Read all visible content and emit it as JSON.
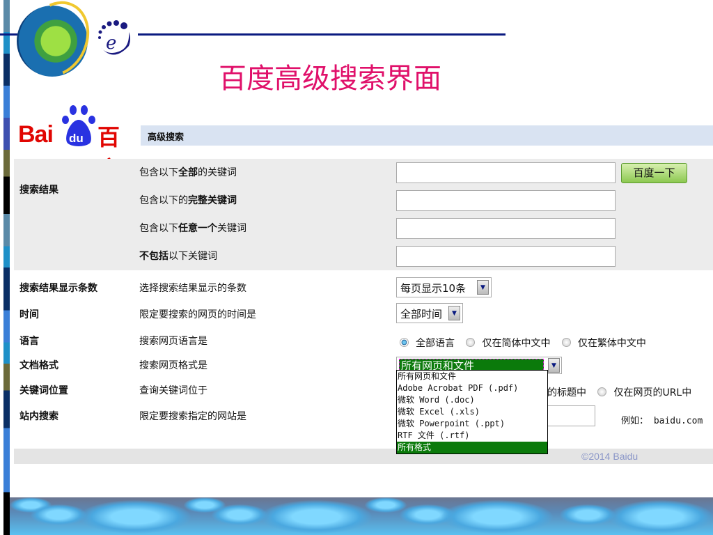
{
  "slide": {
    "title": "百度高级搜索界面"
  },
  "logo": {
    "bai": "Bai",
    "du": "du",
    "cn": "百度"
  },
  "header": {
    "label": "高级搜索"
  },
  "sections": {
    "results_label": "搜索结果",
    "keyword_rows": [
      {
        "pre": "包含以下",
        "bold": "全部",
        "post": "的关键词"
      },
      {
        "pre": "包含以下的",
        "bold": "完整关键词",
        "post": ""
      },
      {
        "pre": "包含以下",
        "bold": "任意一个",
        "post": "关键词"
      },
      {
        "pre": "",
        "bold": "不包括",
        "post": "以下关键词"
      }
    ],
    "search_button": "百度一下",
    "rows": [
      {
        "label": "搜索结果显示条数",
        "desc": "选择搜索结果显示的条数"
      },
      {
        "label": "时间",
        "desc": "限定要搜索的网页的时间是"
      },
      {
        "label": "语言",
        "desc": "搜索网页语言是"
      },
      {
        "label": "文档格式",
        "desc": "搜索网页格式是"
      },
      {
        "label": "关键词位置",
        "desc": "查询关键词位于"
      },
      {
        "label": "站内搜索",
        "desc": "限定要搜索指定的网站是"
      }
    ],
    "count_select": "每页显示10条",
    "time_select": "全部时间",
    "language_options": [
      "全部语言",
      "仅在简体中文中",
      "仅在繁体中文中"
    ],
    "format_select": "所有网页和文件",
    "format_options": [
      "所有网页和文件",
      "Adobe Acrobat PDF (.pdf)",
      "微软 Word (.doc)",
      "微软 Excel (.xls)",
      "微软 Powerpoint (.ppt)",
      "RTF 文件  (.rtf)",
      "所有格式"
    ],
    "position_options_visible": [
      "的标题中",
      "仅在网页的URL中"
    ],
    "site_example": "例如： baidu.com"
  },
  "footer": {
    "copyright": "©2014 Baidu"
  }
}
